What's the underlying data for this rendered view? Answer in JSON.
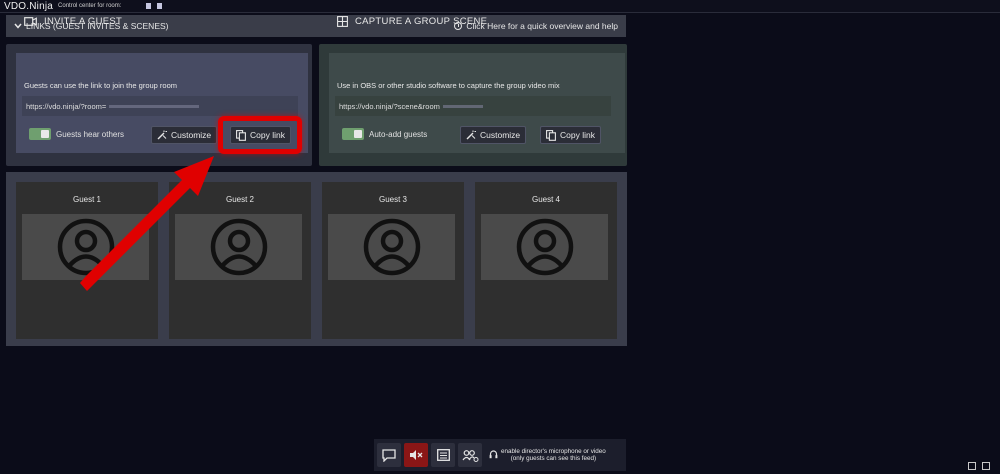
{
  "topbar": {
    "brand": "VDO.Ninja",
    "room_label": "Control center for room:"
  },
  "header": {
    "title": "LINKS (GUEST INVITES & SCENES)",
    "help": "Click Here for a quick overview and help"
  },
  "invite": {
    "title": "INVITE A GUEST",
    "description": "Guests can use the link to join the group room",
    "link": "https://vdo.ninja/?room=",
    "toggle_label": "Guests hear others",
    "customize_label": "Customize",
    "copy_label": "Copy link"
  },
  "capture": {
    "title": "CAPTURE A GROUP SCENE",
    "description": "Use in OBS or other studio software to capture the group video mix",
    "link": "https://vdo.ninja/?scene&room",
    "toggle_label": "Auto-add guests",
    "customize_label": "Customize",
    "copy_label": "Copy link"
  },
  "guests": [
    {
      "name": "Guest 1"
    },
    {
      "name": "Guest 2"
    },
    {
      "name": "Guest 3"
    },
    {
      "name": "Guest 4"
    }
  ],
  "controls": {
    "director_line1": "enable director's microphone or video",
    "director_line2": "(only guests can see this feed)"
  },
  "colors": {
    "highlight": "#e00000",
    "mute": "#8a1616",
    "toggle_on": "#6f9f6f"
  }
}
